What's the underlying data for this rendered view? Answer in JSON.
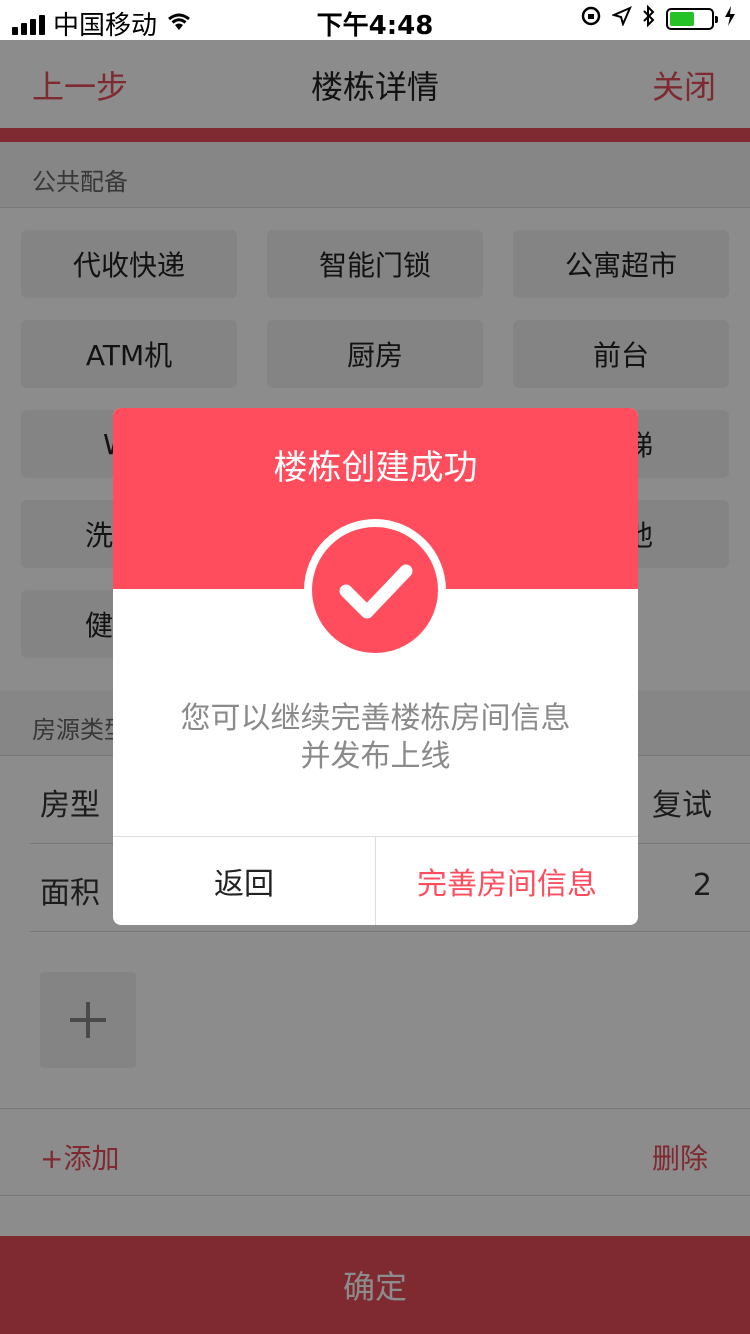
{
  "status_bar": {
    "carrier": "中国移动",
    "time": "下午4:48"
  },
  "nav": {
    "back_label": "上一步",
    "title": "楼栋详情",
    "close_label": "关闭"
  },
  "sections": {
    "facilities_title": "公共配备",
    "room_types_title": "房源类型"
  },
  "facilities": [
    "代收快递",
    "智能门锁",
    "公寓超市",
    "ATM机",
    "厨房",
    "前台",
    "W",
    "梯",
    "洗",
    "池",
    "健"
  ],
  "rows": {
    "room_type": {
      "label": "房型",
      "value": "复试"
    },
    "area": {
      "label": "面积",
      "value": "2"
    }
  },
  "actions": {
    "add_label": "+添加",
    "delete_label": "删除"
  },
  "confirm_label": "确定",
  "modal": {
    "title": "楼栋创建成功",
    "message_line1": "您可以继续完善楼栋房间信息",
    "message_line2": "并发布上线",
    "back_label": "返回",
    "improve_label": "完善房间信息"
  },
  "colors": {
    "accent": "#e84c5a",
    "modal_red": "#ff4d5e"
  }
}
